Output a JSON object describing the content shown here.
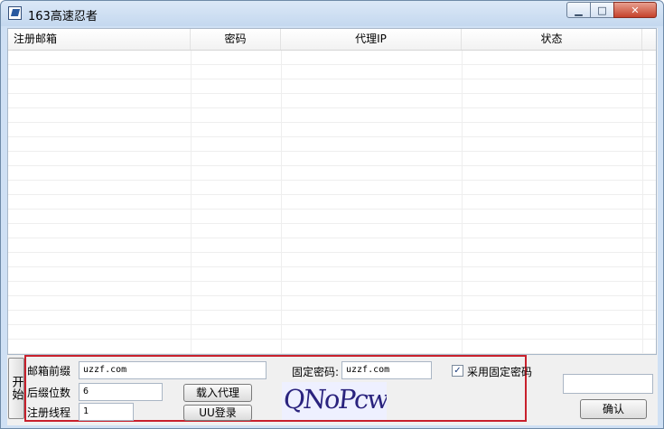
{
  "window": {
    "title": "163高速忍者",
    "controls": {
      "minimize": "▁",
      "maximize": "□",
      "close": "✕"
    }
  },
  "table": {
    "columns": [
      "注册邮箱",
      "密码",
      "代理IP",
      "状态"
    ],
    "rows": []
  },
  "start_button": "开始",
  "form": {
    "email_prefix_label": "邮箱前缀",
    "email_prefix_value": "uzzf.com",
    "suffix_digits_label": "后缀位数",
    "suffix_digits_value": "6",
    "threads_label": "注册线程",
    "threads_value": "1",
    "load_proxy_button": "载入代理",
    "uu_login_button": "UU登录",
    "fixed_password_label": "固定密码:",
    "fixed_password_value": "uzzf.com",
    "use_fixed_password_label": "采用固定密码",
    "use_fixed_password_checked": true,
    "captcha_text": "QNoPcw"
  },
  "captcha_input_value": "",
  "confirm_button": "确认",
  "colors": {
    "highlight_border": "#c8202c"
  }
}
